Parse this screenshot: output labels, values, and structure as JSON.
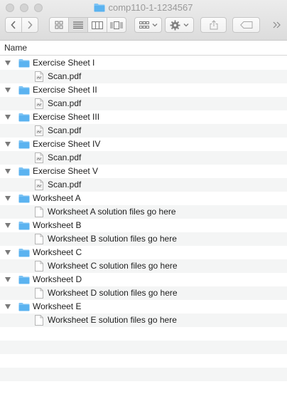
{
  "window": {
    "title": "comp110-1-1234567"
  },
  "toolbar": {
    "buttons": [
      "back",
      "forward",
      "icon-view",
      "list-view",
      "column-view",
      "cover-flow",
      "arrange",
      "action",
      "share",
      "tags",
      "more"
    ]
  },
  "column_header": {
    "name": "Name"
  },
  "items": [
    {
      "type": "folder",
      "label": "Exercise Sheet I"
    },
    {
      "type": "pdf",
      "label": "Scan.pdf"
    },
    {
      "type": "folder",
      "label": "Exercise Sheet II"
    },
    {
      "type": "pdf",
      "label": "Scan.pdf"
    },
    {
      "type": "folder",
      "label": "Exercise Sheet III"
    },
    {
      "type": "pdf",
      "label": "Scan.pdf"
    },
    {
      "type": "folder",
      "label": "Exercise Sheet IV"
    },
    {
      "type": "pdf",
      "label": "Scan.pdf"
    },
    {
      "type": "folder",
      "label": "Exercise Sheet V"
    },
    {
      "type": "pdf",
      "label": "Scan.pdf"
    },
    {
      "type": "folder",
      "label": "Worksheet A"
    },
    {
      "type": "doc",
      "label": "Worksheet A solution files go here"
    },
    {
      "type": "folder",
      "label": "Worksheet B"
    },
    {
      "type": "doc",
      "label": "Worksheet B solution files go here"
    },
    {
      "type": "folder",
      "label": "Worksheet C"
    },
    {
      "type": "doc",
      "label": "Worksheet C solution files go here"
    },
    {
      "type": "folder",
      "label": "Worksheet D"
    },
    {
      "type": "doc",
      "label": "Worksheet D solution files go here"
    },
    {
      "type": "folder",
      "label": "Worksheet E"
    },
    {
      "type": "doc",
      "label": "Worksheet E solution files go here"
    }
  ],
  "colors": {
    "folder": "#5bb3f0",
    "stripe": "#f4f5f5"
  }
}
